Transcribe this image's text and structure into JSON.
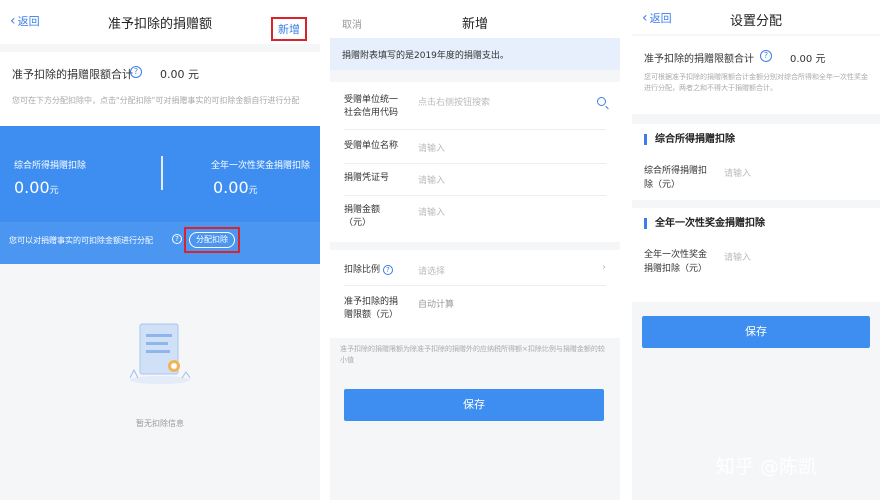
{
  "panel1": {
    "nav": {
      "back": "返回",
      "title": "准予扣除的捐赠额",
      "action": "新增"
    },
    "limit": {
      "label": "准予扣除的捐赠限额合计",
      "value": "0.00 元",
      "hint": "您可在下方分配扣除中，点击\"分配扣除\"可对捐赠事实的可扣除金额自行进行分配"
    },
    "card": {
      "left_label": "综合所得捐赠扣除",
      "left_value": "0.00",
      "left_unit": "元",
      "right_label": "全年一次性奖金捐赠扣除",
      "right_value": "0.00",
      "right_unit": "元",
      "hint": "您可以对捐赠事实的可扣除金额进行分配",
      "button": "分配扣除"
    },
    "empty_text": "暂无扣除信息"
  },
  "panel2": {
    "nav": {
      "cancel": "取消",
      "title": "新增"
    },
    "banner": "捐赠附表填写的是2019年度的捐赠支出。",
    "fields": [
      {
        "label": "受赠单位统一社会信用代码",
        "placeholder": "点击右侧按钮搜索"
      },
      {
        "label": "受赠单位名称",
        "placeholder": "请输入"
      },
      {
        "label": "捐赠凭证号",
        "placeholder": "请输入"
      },
      {
        "label": "捐赠金额（元）",
        "placeholder": "请输入"
      }
    ],
    "ratio": {
      "label": "扣除比例",
      "placeholder": "请选择"
    },
    "allowed": {
      "label": "准予扣除的捐赠限额（元）",
      "value": "自动计算"
    },
    "note": "准予扣除的捐赠限额为除准予扣除的捐赠外的应纳税所得额×扣除比例与捐赠金额的较小值",
    "save": "保存"
  },
  "panel3": {
    "nav": {
      "back": "返回",
      "title": "设置分配"
    },
    "limit": {
      "label": "准予扣除的捐赠限额合计",
      "value": "0.00 元",
      "hint": "您可根据准予扣除的捐赠限额合计金额分别对综合所得和全年一次性奖金进行分配，两者之和不得大于捐赠额合计。"
    },
    "section1": {
      "title": "综合所得捐赠扣除",
      "label": "综合所得捐赠扣除（元）",
      "placeholder": "请输入"
    },
    "section2": {
      "title": "全年一次性奖金捐赠扣除",
      "label": "全年一次性奖金捐赠扣除（元）",
      "placeholder": "请输入"
    },
    "save": "保存"
  },
  "watermark": "知乎 @陈凯",
  "colors": {
    "accent": "#3d8ef0",
    "highlight": "#d9232d"
  }
}
